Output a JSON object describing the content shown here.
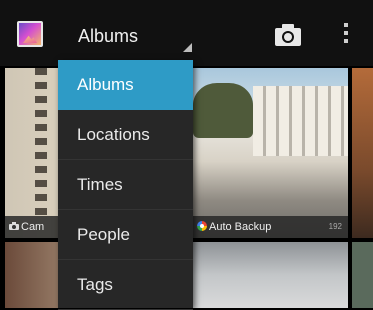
{
  "action_bar": {
    "app_icon": "gallery-icon",
    "spinner_label": "Albums",
    "camera_icon": "camera-icon",
    "overflow_icon": "more-vertical-icon"
  },
  "albums": [
    {
      "label": "Cam",
      "icon": "camera-icon",
      "count": ""
    },
    {
      "label": "Auto Backup",
      "icon": "picasa-icon",
      "count": "192"
    }
  ],
  "menu": {
    "items": [
      {
        "label": "Albums",
        "selected": true
      },
      {
        "label": "Locations",
        "selected": false
      },
      {
        "label": "Times",
        "selected": false
      },
      {
        "label": "People",
        "selected": false
      },
      {
        "label": "Tags",
        "selected": false
      }
    ],
    "accent_color": "#2e9bc6"
  }
}
